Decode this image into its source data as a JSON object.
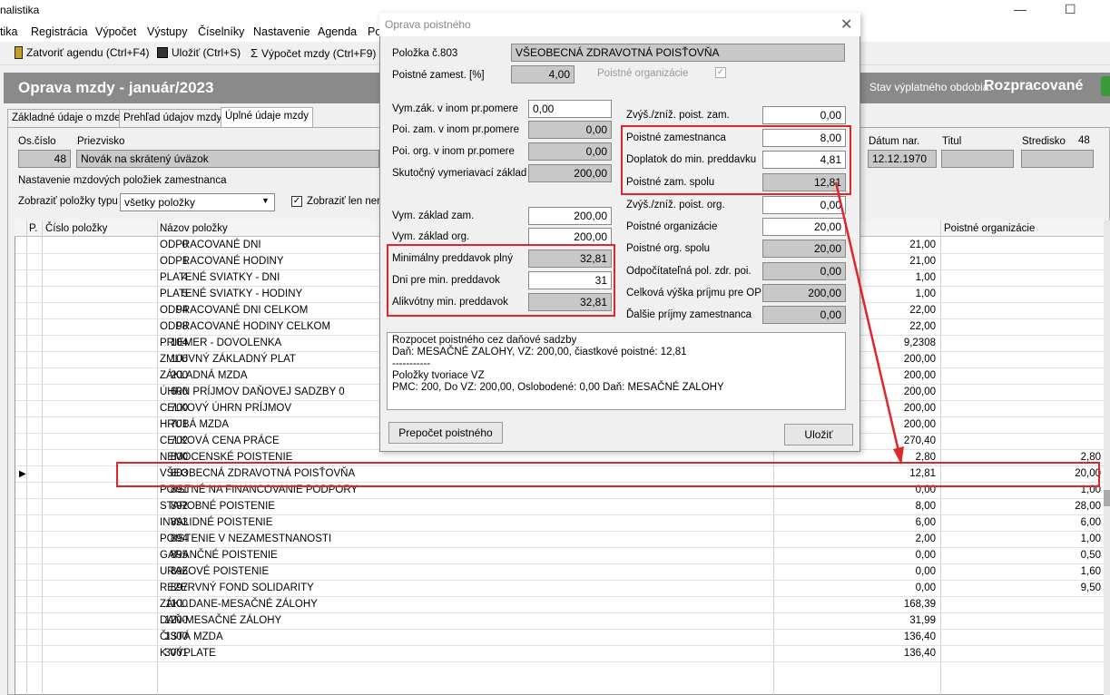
{
  "app": {
    "title": "nalistika"
  },
  "menu": [
    "tika",
    "Registrácia",
    "Výpočet",
    "Výstupy",
    "Číselníky",
    "Nastavenie",
    "Agenda",
    "Po"
  ],
  "toolbar": {
    "close": "Zatvoriť agendu (Ctrl+F4)",
    "save": "Uložiť (Ctrl+S)",
    "calc": "Výpočet mzdy (Ctrl+F9)"
  },
  "banner": {
    "title": "Oprava mzdy -  január/2023",
    "state_label": "Stav výplatného obdobia:",
    "state": "Rozpracované"
  },
  "tabs": [
    "Základné údaje o mzde",
    "Prehľad údajov mzdy",
    "Úplné údaje mzdy"
  ],
  "employee": {
    "oscislo_label": "Os.číslo",
    "oscislo": "48",
    "priezvisko_label": "Priezvisko",
    "priezvisko": "Novák na skrátený úväzok",
    "datum_label": "Dátum nar.",
    "datum": "12.12.1970",
    "titul_label": "Titul",
    "stredisko_label": "Stredisko",
    "stredisko": "48"
  },
  "group": {
    "label": "Nastavenie mzdových položiek zamestnanca",
    "filter_label": "Zobraziť položky typu",
    "filter_value": "všetky položky",
    "checkbox_label": "Zobraziť len nenu"
  },
  "grid": {
    "headers": {
      "p": "P.",
      "cislo": "Číslo položky",
      "nazov": "Názov položky",
      "org": "Poistné organizácie"
    },
    "rows": [
      {
        "num": "0",
        "name": "ODPRACOVANÉ DNI",
        "val": "21,00",
        "org": ""
      },
      {
        "num": "1",
        "name": "ODPRACOVANÉ HODINY",
        "val": "21,00",
        "org": ""
      },
      {
        "num": "4",
        "name": "PLATENÉ SVIATKY - DNI",
        "val": "1,00",
        "org": ""
      },
      {
        "num": "5",
        "name": "PLATENÉ SVIATKY - HODINY",
        "val": "1,00",
        "org": ""
      },
      {
        "num": "94",
        "name": "ODPRACOVANÉ DNI CELKOM",
        "val": "22,00",
        "org": ""
      },
      {
        "num": "98",
        "name": "ODPRACOVANÉ HODINY CELKOM",
        "val": "22,00",
        "org": ""
      },
      {
        "num": "104",
        "name": "PRIEMER - DOVOLENKA",
        "val": "9,2308",
        "org": ""
      },
      {
        "num": "106",
        "name": "ZMLUVNÝ ZÁKLADNÝ PLAT",
        "val": "200,00",
        "org": ""
      },
      {
        "num": "200",
        "name": "ZÁKLADNÁ MZDA",
        "val": "200,00",
        "org": ""
      },
      {
        "num": "600",
        "name": "ÚHRN PRÍJMOV DAŇOVEJ SADZBY 0",
        "val": "200,00",
        "org": ""
      },
      {
        "num": "700",
        "name": "CELKOVÝ ÚHRN PRÍJMOV",
        "val": "200,00",
        "org": ""
      },
      {
        "num": "701",
        "name": "HRUBÁ MZDA",
        "val": "200,00",
        "org": ""
      },
      {
        "num": "702",
        "name": "CELKOVÁ CENA PRÁCE",
        "val": "270,40",
        "org": ""
      },
      {
        "num": "800",
        "name": "NEMOCENSKÉ POISTENIE",
        "val": "2,80",
        "org": "2,80"
      },
      {
        "num": "803",
        "name": "VŠEOBECNÁ ZDRAVOTNÁ POISŤOVŇA",
        "val": "12,81",
        "org": "20,00"
      },
      {
        "num": "891",
        "name": "POISTNÉ NA FINANCOVANIE PODPORY",
        "val": "0,00",
        "org": "1,00"
      },
      {
        "num": "892",
        "name": "STAROBNÉ POISTENIE",
        "val": "8,00",
        "org": "28,00"
      },
      {
        "num": "893",
        "name": "INVALIDNÉ POISTENIE",
        "val": "6,00",
        "org": "6,00"
      },
      {
        "num": "894",
        "name": "POISTENIE V NEZAMESTNANOSTI",
        "val": "2,00",
        "org": "1,00"
      },
      {
        "num": "895",
        "name": "GARANČNÉ POISTENIE",
        "val": "0,00",
        "org": "0,50"
      },
      {
        "num": "896",
        "name": "URAZOVÉ POISTENIE",
        "val": "0,00",
        "org": "1,60"
      },
      {
        "num": "897",
        "name": "REZERVNÝ FOND SOLIDARITY",
        "val": "0,00",
        "org": "9,50"
      },
      {
        "num": "1100",
        "name": "ZÁKL.DANE-MESAČNÉ ZÁLOHY",
        "val": "168,39",
        "org": ""
      },
      {
        "num": "1200",
        "name": "DAŇ-MESAČNÉ ZÁLOHY",
        "val": "31,99",
        "org": ""
      },
      {
        "num": "1300",
        "name": "ČISTÁ MZDA",
        "val": "136,40",
        "org": ""
      },
      {
        "num": "3001",
        "name": "K VÝPLATE",
        "val": "136,40",
        "org": ""
      }
    ]
  },
  "dialog": {
    "title": "Oprava poistného",
    "polozka_label": "Položka č.803",
    "polozka": "VŠEOBECNÁ ZDRAVOTNÁ POISŤOVŇA",
    "pz_label": "Poistné zamest. [%]",
    "pz": "4,00",
    "po_label": "Poistné organizácie",
    "left": [
      {
        "label": "Vym.zák. v inom pr.pomere",
        "value": "0,00",
        "white": true
      },
      {
        "label": "Poi. zam. v inom pr.pomere",
        "value": "0,00",
        "white": false
      },
      {
        "label": "Poi. org. v inom pr.pomere",
        "value": "0,00",
        "white": false
      },
      {
        "label": "Skutočný vymeriavací základ",
        "value": "200,00",
        "white": false
      },
      {
        "label": "Vym. základ zam.",
        "value": "200,00",
        "white": true
      },
      {
        "label": "Vym. základ org.",
        "value": "200,00",
        "white": true
      },
      {
        "label": "Minimálny preddavok plný",
        "value": "32,81",
        "white": false
      },
      {
        "label": "Dni pre min. preddavok",
        "value": "31",
        "white": true
      },
      {
        "label": "Alikvótny min. preddavok",
        "value": "32,81",
        "white": false
      }
    ],
    "right": [
      {
        "label": "Zvýš./zníž. poist. zam.",
        "value": "0,00",
        "white": true
      },
      {
        "label": "Poistné zamestnanca",
        "value": "8,00",
        "white": true
      },
      {
        "label": "Doplatok do min. preddavku",
        "value": "4,81",
        "white": true
      },
      {
        "label": "Poistné zam. spolu",
        "value": "12,81",
        "white": false
      },
      {
        "label": "Zvýš./zníž. poist. org.",
        "value": "0,00",
        "white": true
      },
      {
        "label": "Poistné organizácie",
        "value": "20,00",
        "white": true
      },
      {
        "label": "Poistné org. spolu",
        "value": "20,00",
        "white": false
      },
      {
        "label": "Odpočítateľná pol. zdr. poi.",
        "value": "0,00",
        "white": false
      },
      {
        "label": "Celková výška príjmu pre OP",
        "value": "200,00",
        "white": false
      },
      {
        "label": "Ďalšie príjmy zamestnanca",
        "value": "0,00",
        "white": false
      }
    ],
    "note": [
      "Rozpocet poistného cez daňové sadzby",
      "Daň: MESAČNÉ ZALOHY, VZ: 200,00, čiastkové poistné: 12,81",
      "-----------",
      "Položky tvoriace VZ",
      "PMC: 200, Do VZ: 200,00, Oslobodené: 0,00 Daň: MESAČNÉ ZALOHY"
    ],
    "recalc": "Prepočet  poistného",
    "save": "Uložiť"
  },
  "colors": {
    "highlight": "#e0262a",
    "banner": "#8a8a8a"
  }
}
